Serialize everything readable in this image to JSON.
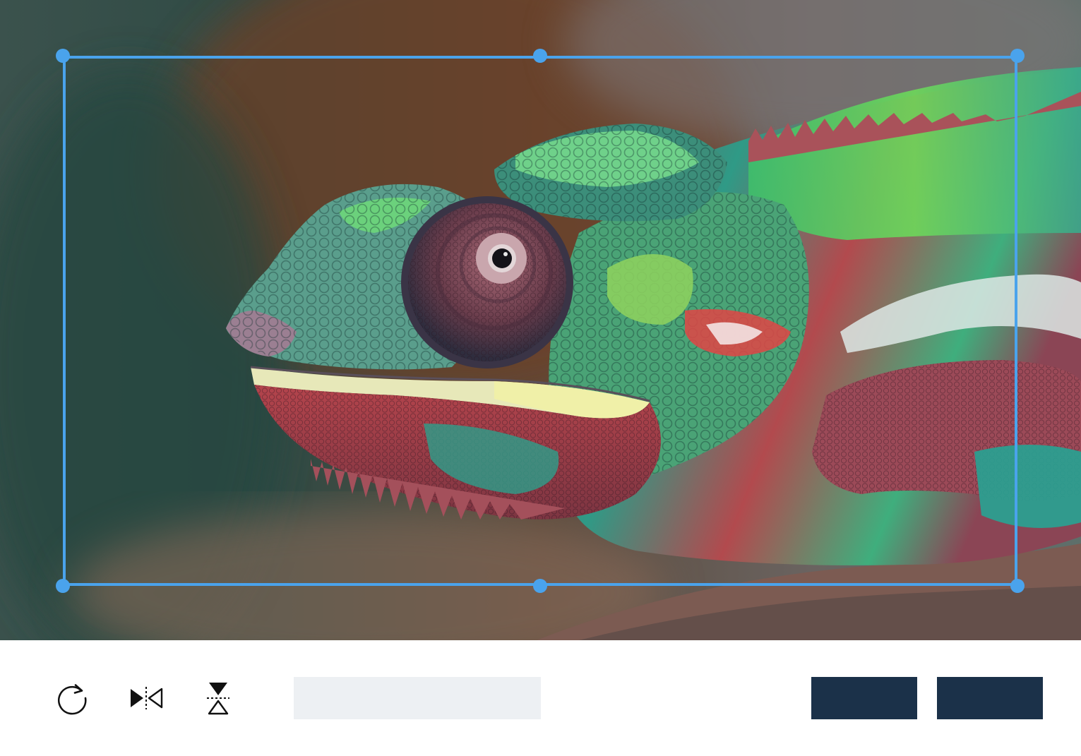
{
  "image": {
    "subject": "chameleon-photo",
    "alt": ""
  },
  "crop": {
    "accent_color": "#4aa3ec"
  },
  "toolbar": {
    "rotate_icon": "rotate-clockwise-icon",
    "flip_horizontal_icon": "flip-horizontal-icon",
    "flip_vertical_icon": "flip-vertical-icon",
    "aspect_value": "",
    "cancel_label": "",
    "apply_label": "",
    "button_color": "#1b3149",
    "field_color": "#edf0f3"
  }
}
